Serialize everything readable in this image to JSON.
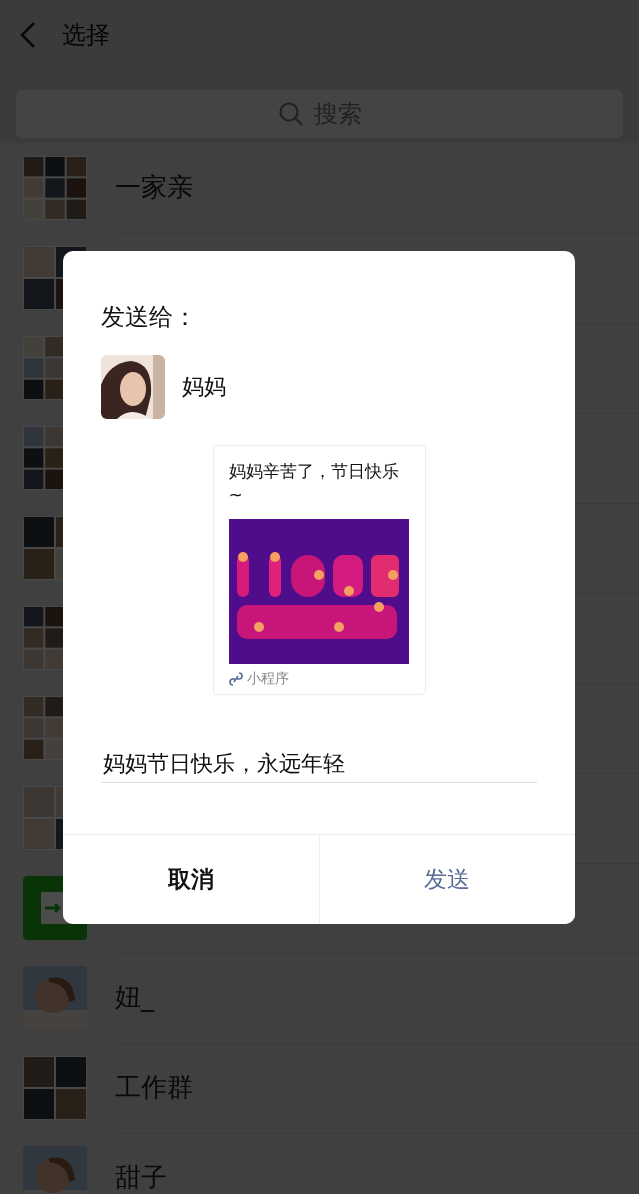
{
  "header": {
    "title": "选择"
  },
  "search": {
    "placeholder": "搜索"
  },
  "contacts": [
    {
      "kind": "group",
      "name": "一家亲"
    },
    {
      "kind": "group"
    },
    {
      "kind": "group"
    },
    {
      "kind": "group"
    },
    {
      "kind": "group"
    },
    {
      "kind": "group"
    },
    {
      "kind": "group"
    },
    {
      "kind": "group"
    },
    {
      "kind": "file"
    },
    {
      "kind": "person",
      "name": "妞_"
    },
    {
      "kind": "group",
      "name": "工作群"
    },
    {
      "kind": "person",
      "name": "甜子"
    }
  ],
  "dialog": {
    "title": "发送给：",
    "recipient": {
      "name": "妈妈"
    },
    "card": {
      "title": "妈妈辛苦了，节日快乐~",
      "source": "小程序"
    },
    "message": {
      "value": "妈妈节日快乐，永远年轻"
    },
    "buttons": [
      {
        "label": "取消",
        "kind": "cancel"
      },
      {
        "label": "发送",
        "kind": "primary"
      }
    ]
  }
}
